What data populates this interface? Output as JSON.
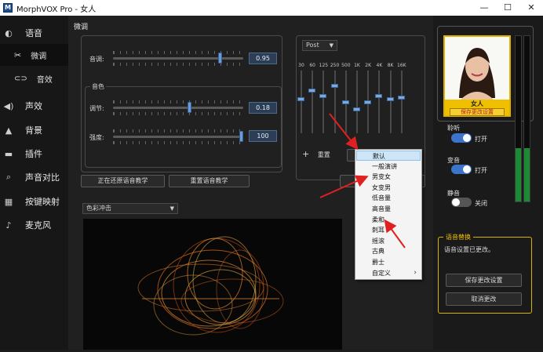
{
  "window": {
    "title": "MorphVOX Pro - 女人",
    "app_icon": "M",
    "minimize": "—",
    "maximize": "☐",
    "close": "✕"
  },
  "sidebar": {
    "items": [
      {
        "label": "语音",
        "icon": "voice-icon"
      },
      {
        "label": "微调",
        "icon": "tools-icon"
      },
      {
        "label": "音效",
        "icon": "lips-icon"
      },
      {
        "label": "声效",
        "icon": "speaker-icon"
      },
      {
        "label": "背景",
        "icon": "mountain-icon"
      },
      {
        "label": "插件",
        "icon": "plugin-icon"
      },
      {
        "label": "声音对比",
        "icon": "magnifier-icon"
      },
      {
        "label": "按键映射",
        "icon": "keyboard-icon"
      },
      {
        "label": "麦克风",
        "icon": "microphone-icon"
      }
    ]
  },
  "tweak": {
    "section_title": "微调",
    "pitch": {
      "label": "音调:",
      "value": "0.95",
      "level": 0.83
    },
    "timbre_group": "音色",
    "adjust": {
      "label": "调节:",
      "value": "0.18",
      "level": 0.59
    },
    "strength": {
      "label": "强度:",
      "value": "100",
      "level": 1.0
    },
    "reset_buttons": [
      "正在还原语音教学",
      "重置语音教学"
    ]
  },
  "eq": {
    "preset": "Post",
    "bands": [
      "30",
      "60",
      "125",
      "250",
      "500",
      "1K",
      "2K",
      "4K",
      "8K",
      "16K"
    ],
    "levels": [
      0.55,
      0.7,
      0.6,
      0.78,
      0.5,
      0.38,
      0.5,
      0.6,
      0.55,
      0.58
    ],
    "reset_label": "重置",
    "add_icon": "+"
  },
  "preset_menu": {
    "items": [
      "默认",
      "一般演讲",
      "男变女",
      "女变男",
      "低音量",
      "高音量",
      "柔和",
      "刺耳",
      "摇滚",
      "古典",
      "爵士",
      "自定义"
    ],
    "selected": "默认",
    "submenu_arrow": "›"
  },
  "viz": {
    "select": "色彩冲击"
  },
  "voice_panel": {
    "avatar_name": "女人",
    "avatar_button": "保存更改设置",
    "listen": {
      "label": "聆听",
      "state": "打开",
      "on": true
    },
    "morph": {
      "label": "变音",
      "state": "打开",
      "on": true
    },
    "mute": {
      "label": "静音",
      "state": "关闭",
      "on": false
    },
    "meter_levels": [
      0.32,
      0.32
    ]
  },
  "change_panel": {
    "title": "语音替换",
    "message": "语音设置已更改。",
    "save_button": "保存更改设置",
    "cancel_button": "取消更改"
  },
  "colors": {
    "accent": "#3b74c9",
    "highlight_yellow": "#f0c000",
    "arrow_red": "#e02020"
  }
}
